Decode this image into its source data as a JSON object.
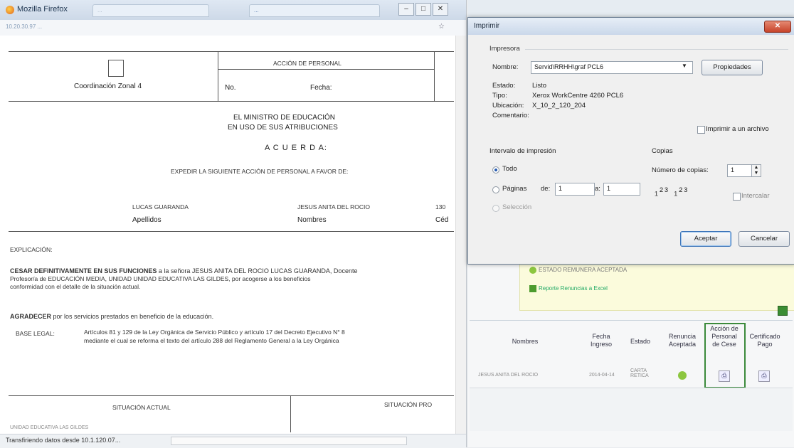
{
  "browser": {
    "title": "Mozilla Firefox",
    "tab1": "...",
    "tab2": "...",
    "url": "10.20.30.97 ...",
    "status": "Transfiriendo datos desde 10.1.120.07..."
  },
  "document": {
    "coordinacion": "Coordinación Zonal 4",
    "accion_header": "ACCIÓN DE PERSONAL",
    "no_label": "No.",
    "fecha_label": "Fecha:",
    "ministro_line1": "EL MINISTRO DE EDUCACIÓN",
    "ministro_line2": "EN USO DE SUS ATRIBUCIONES",
    "acuerda": "A C U E R D A:",
    "expedir": "EXPEDIR LA SIGUIENTE ACCIÓN DE PERSONAL A FAVOR DE:",
    "apellidos_value": "LUCAS GUARANDA",
    "apellidos_label": "Apellidos",
    "nombres_value": "JESUS ANITA DEL ROCIO",
    "nombres_label": "Nombres",
    "cedula_value": "130",
    "cedula_label": "Céd",
    "explicacion": "EXPLICACIÓN:",
    "cesar_bold": "CESAR DEFINITIVAMENTE EN SUS FUNCIONES",
    "cesar_rest": " a la señora JESUS ANITA DEL ROCIO LUCAS GUARANDA, Docente",
    "cesar_line2": "Profesor/a de EDUCACIÓN MEDIA, UNIDAD UNIDAD EDUCATIVA LAS GILDES, por acogerse a los beneficios",
    "cesar_line3": "conformidad con el detalle de la situación actual.",
    "agradecer_bold": "AGRADECER",
    "agradecer_rest": " por los servicios prestados en beneficio de la educación.",
    "base_legal_label": "BASE LEGAL:",
    "base_legal_line1": "Artículos 81 y 129 de la Ley Orgánica de Servicio Público y artículo 17 del Decreto Ejecutivo N° 8",
    "base_legal_line2": "mediante el cual se reforma el texto del artículo 288 del Reglamento General a la Ley Orgánica",
    "situacion_actual": "SITUACIÓN ACTUAL",
    "situacion_pro": "SITUACIÓN PRO",
    "unidad_text": "UNIDAD EDUCATIVA LAS GILDES"
  },
  "right_panel": {
    "msg1": "ESTADO REMUNERA ACEPTADA",
    "msg2": "Reporte Renuncias a Excel",
    "col_nombres": "Nombres",
    "col_fecha": "Fecha Ingreso",
    "col_estado": "Estado",
    "col_renuncia": "Renuncia Aceptada",
    "col_accion": "Acción de Personal de Cese",
    "col_certificado": "Certificado Pago",
    "row_nombre": "JESUS ANITA DEL ROCIO",
    "row_fecha": "2014-04-14",
    "row_estado": "CARTA RETICA"
  },
  "print_dialog": {
    "title": "Imprimir",
    "impresora_group": "Impresora",
    "nombre_label": "Nombre:",
    "nombre_value": "Servid\\RRHH\\graf PCL6",
    "propiedades_button": "Propiedades",
    "estado_label": "Estado:",
    "estado_value": "Listo",
    "tipo_label": "Tipo:",
    "tipo_value": "Xerox WorkCentre 4260 PCL6",
    "ubicacion_label": "Ubicación:",
    "ubicacion_value": "X_10_2_120_204",
    "comentario_label": "Comentario:",
    "imprimir_archivo": "Imprimir a un archivo",
    "intervalo_label": "Intervalo de impresión",
    "todo_label": "Todo",
    "paginas_label": "Páginas",
    "de_label": "de:",
    "de_value": "1",
    "a_label": "a:",
    "a_value": "1",
    "seleccion_label": "Selección",
    "copias_label": "Copias",
    "numero_copias_label": "Número de copias:",
    "numero_copias_value": "1",
    "intercalar_label": "Intercalar",
    "aceptar_button": "Aceptar",
    "cancelar_button": "Cancelar"
  }
}
